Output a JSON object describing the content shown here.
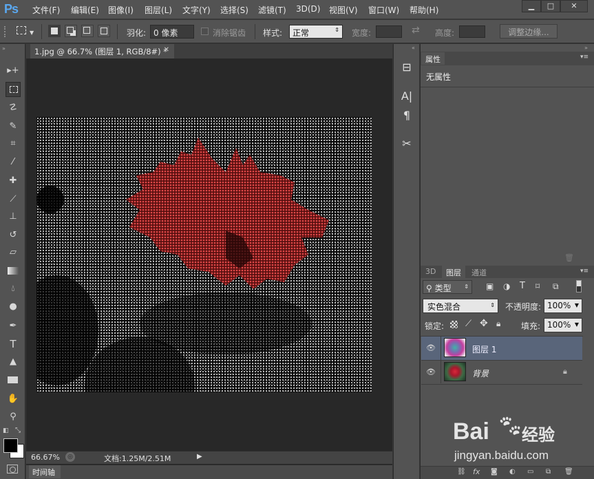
{
  "app": {
    "logo": "Ps",
    "menu": [
      "文件(F)",
      "编辑(E)",
      "图像(I)",
      "图层(L)",
      "文字(Y)",
      "选择(S)",
      "滤镜(T)",
      "3D(D)",
      "视图(V)",
      "窗口(W)",
      "帮助(H)"
    ]
  },
  "options": {
    "feather_label": "羽化:",
    "feather_value": "0 像素",
    "antialias_label": "消除锯齿",
    "style_label": "样式:",
    "style_value": "正常",
    "width_label": "宽度:",
    "height_label": "高度:",
    "refine_edge_label": "调整边缘..."
  },
  "document": {
    "tab_title": "1.jpg @ 66.7% (图层 1, RGB/8#) *",
    "zoom": "66.67%",
    "doc_info": "文档:1.25M/2.51M",
    "timeline_label": "时间轴"
  },
  "properties": {
    "tab": "属性",
    "empty_text": "无属性"
  },
  "layers_panel": {
    "tabs": [
      "3D",
      "图层",
      "通道"
    ],
    "filter_kind": "类型",
    "blend_mode": "实色混合",
    "opacity_label": "不透明度:",
    "opacity_value": "100%",
    "lock_label": "锁定:",
    "fill_label": "填充:",
    "fill_value": "100%",
    "layers": [
      {
        "name": "图层 1",
        "selected": true
      },
      {
        "name": "背景",
        "selected": false
      }
    ]
  },
  "watermark": {
    "brand_left": "Bai",
    "brand_right": "经验",
    "url": "jingyan.baidu.com"
  },
  "colors": {
    "accent_blue": "#5aa8f0",
    "selected_layer": "#59657a",
    "flower_red": "#c8373a"
  }
}
